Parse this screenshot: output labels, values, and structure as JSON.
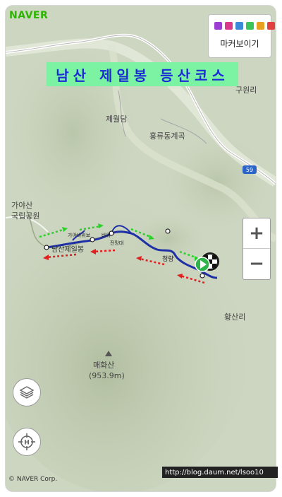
{
  "logo": "NAVER",
  "title": "남산 제일봉 등산코스",
  "marker_button": {
    "label": "마커보이기"
  },
  "zoom": {
    "in": "+",
    "out": "−"
  },
  "copyright": "© NAVER Corp.",
  "watermark": "http://blog.daum.net/lsoo10",
  "road_badge": "59",
  "places": {
    "guwon": "구원리",
    "jeilwol": "제월담",
    "hongryu": "홍류동계곡",
    "gaya1": "가야산",
    "gaya2": "국립공원",
    "hwangsan": "황산리",
    "maehwa": "매화산",
    "maehwa_elev": "(953.9m)",
    "namsan": "남산제일봉",
    "trail1": "가야바위보",
    "trail2": "바위",
    "trail3": "전망대",
    "trail4": "청량"
  },
  "colors": {
    "route": "#1f2fa6",
    "ascent_arrow": "#2ad12a",
    "descent_arrow": "#e02020",
    "banner_bg": "#7cf3a2",
    "banner_text": "#1b2bd6",
    "logo": "#2db400"
  },
  "icons": [
    "layers-icon",
    "location-crosshair-icon",
    "start-flag-icon",
    "mountain-peak-icon"
  ]
}
